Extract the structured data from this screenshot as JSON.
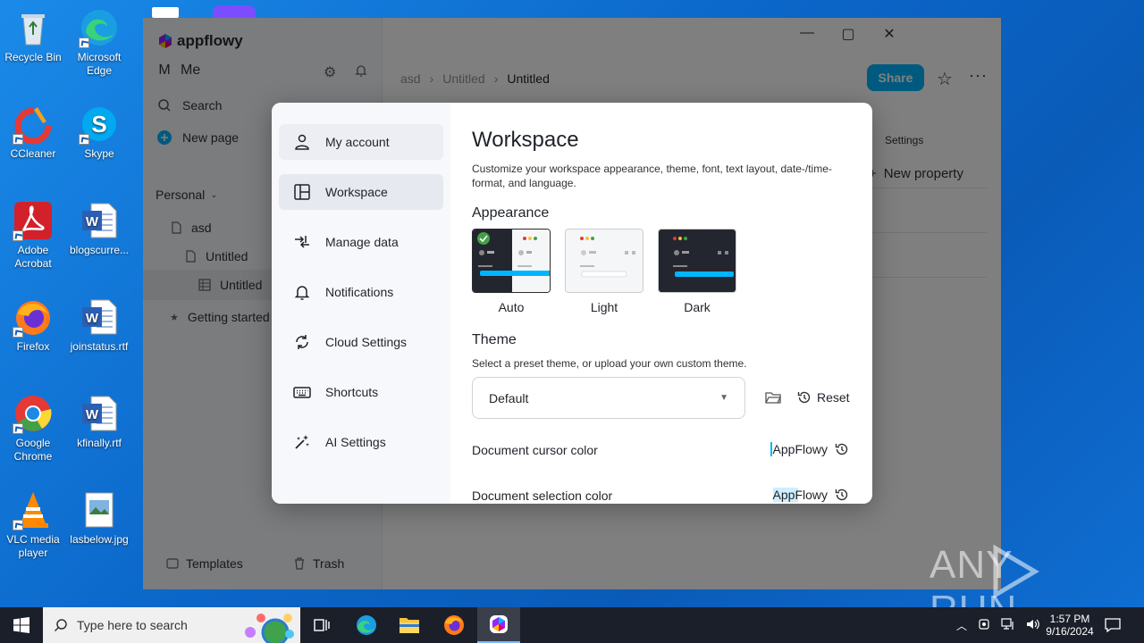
{
  "desktop": {
    "icons": [
      {
        "label": "Recycle Bin",
        "icon": "recycle-bin-icon"
      },
      {
        "label": "Microsoft Edge",
        "icon": "edge-icon"
      },
      {
        "label": "CCleaner",
        "icon": "ccleaner-icon"
      },
      {
        "label": "Skype",
        "icon": "skype-icon"
      },
      {
        "label": "Adobe Acrobat",
        "icon": "acrobat-icon"
      },
      {
        "label": "blogscurre...",
        "icon": "word-doc-icon"
      },
      {
        "label": "Firefox",
        "icon": "firefox-icon"
      },
      {
        "label": "joinstatus.rtf",
        "icon": "word-doc-icon"
      },
      {
        "label": "Google Chrome",
        "icon": "chrome-icon"
      },
      {
        "label": "kfinally.rtf",
        "icon": "word-doc-icon"
      },
      {
        "label": "VLC media player",
        "icon": "vlc-icon"
      },
      {
        "label": "lasbelow.jpg",
        "icon": "image-file-icon"
      }
    ]
  },
  "app": {
    "logo_text": "appflowy",
    "user_initial": "M",
    "user_name": "Me",
    "search_label": "Search",
    "new_page_label": "New page",
    "section_label": "Personal",
    "tree": [
      {
        "label": "asd",
        "icon": "page-icon"
      },
      {
        "label": "Untitled",
        "icon": "page-icon"
      },
      {
        "label": "Untitled",
        "icon": "grid-icon"
      },
      {
        "label": "Getting started",
        "icon": "star-icon"
      }
    ],
    "templates_label": "Templates",
    "trash_label": "Trash",
    "breadcrumb": [
      "asd",
      "Untitled",
      "Untitled"
    ],
    "share_label": "Share",
    "bg_settings_label": "Settings",
    "bg_new_property_label": "New property"
  },
  "dialog": {
    "nav": [
      {
        "label": "My account",
        "icon": "person-icon"
      },
      {
        "label": "Workspace",
        "icon": "layout-icon"
      },
      {
        "label": "Manage data",
        "icon": "data-arrows-icon"
      },
      {
        "label": "Notifications",
        "icon": "bell-icon"
      },
      {
        "label": "Cloud Settings",
        "icon": "sync-icon"
      },
      {
        "label": "Shortcuts",
        "icon": "keyboard-icon"
      },
      {
        "label": "AI Settings",
        "icon": "ai-wand-icon"
      }
    ],
    "active_nav": "Workspace",
    "title": "Workspace",
    "description": "Customize your workspace appearance, theme, font, text layout, date-/time-format, and language.",
    "appearance_heading": "Appearance",
    "appearance_options": [
      "Auto",
      "Light",
      "Dark"
    ],
    "appearance_selected": "Auto",
    "theme_heading": "Theme",
    "theme_hint": "Select a preset theme, or upload your own custom theme.",
    "theme_value": "Default",
    "reset_label": "Reset",
    "cursor_color_label": "Document cursor color",
    "cursor_color_value": "AppFlowy",
    "selection_color_label": "Document selection color",
    "selection_color_value": "AppFlowy"
  },
  "taskbar": {
    "search_placeholder": "Type here to search",
    "time": "1:57 PM",
    "date": "9/16/2024"
  },
  "watermark": "ANY RUN",
  "colors": {
    "accent": "#00b5ff",
    "desktop": "#0b66c9",
    "taskbar": "#1b1f2a"
  }
}
